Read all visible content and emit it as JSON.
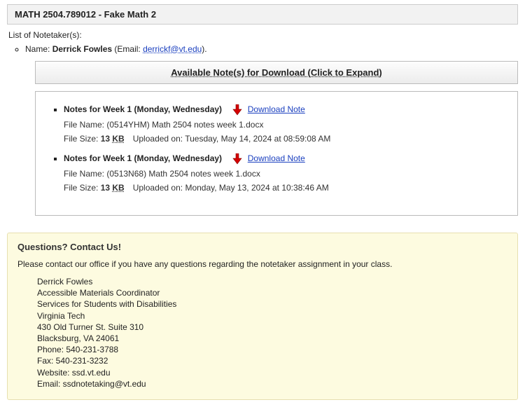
{
  "course": {
    "header": "MATH 2504.789012 - Fake Math 2"
  },
  "labels": {
    "list_of_notetakers": "List of Notetaker(s):",
    "name_prefix": "Name: ",
    "email_prefix": " (Email: ",
    "email_suffix": ").",
    "expand_bar": "Available Note(s) for Download (Click to Expand)",
    "file_name_prefix": "File Name: ",
    "file_size_prefix": "File Size: ",
    "uploaded_prefix": "Uploaded on: ",
    "download_note": "Download Note"
  },
  "notetaker": {
    "name": "Derrick Fowles",
    "email": "derrickf@vt.edu"
  },
  "notes": [
    {
      "title": "Notes for Week 1 (Monday, Wednesday)",
      "file_name": "(0514YHM) Math 2504 notes week 1.docx",
      "file_size_value": "13 ",
      "file_size_unit": "KB",
      "uploaded": "Tuesday, May 14, 2024 at 08:59:08 AM"
    },
    {
      "title": "Notes for Week 1 (Monday, Wednesday)",
      "file_name": "(0513N68) Math 2504 notes week 1.docx",
      "file_size_value": "13 ",
      "file_size_unit": "KB",
      "uploaded": "Monday, May 13, 2024 at 10:38:46 AM"
    }
  ],
  "contact": {
    "heading": "Questions? Contact Us!",
    "intro": "Please contact our office if you have any questions regarding the notetaker assignment in your class.",
    "lines": {
      "name": "Derrick Fowles",
      "title": "Accessible Materials Coordinator",
      "dept": "Services for Students with Disabilities",
      "univ": "Virginia Tech",
      "street": "430 Old Turner St. Suite 310",
      "citystate": "Blacksburg, VA 24061",
      "phone": "Phone: 540-231-3788",
      "fax": "Fax: 540-231-3232",
      "website": "Website: ssd.vt.edu",
      "email": "Email: ssdnotetaking@vt.edu"
    }
  }
}
